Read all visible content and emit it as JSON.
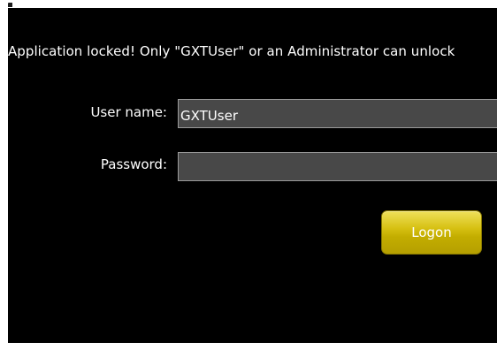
{
  "lock_message": "Application locked! Only \"GXTUser\" or an Administrator can unlock",
  "form": {
    "user_name_label": "User name:",
    "user_name_value": "GXTUser",
    "password_label": "Password:",
    "password_value": "",
    "logon_label": "Logon"
  },
  "colors": {
    "panel_background": "#000000",
    "input_background": "#484848",
    "button_gold": "#c9b200",
    "text": "#ffffff"
  }
}
